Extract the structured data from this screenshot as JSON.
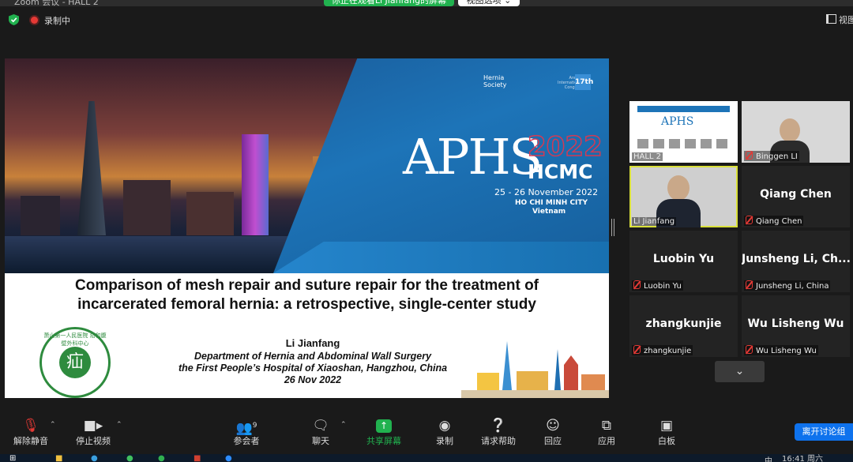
{
  "window": {
    "title": "Zoom 会议 - HALL 2",
    "share_banner": "你正在观看Li Jianfang的屏幕",
    "view_options": "视图选项 ⌄"
  },
  "top_bar": {
    "recording": "录制中",
    "view": "视图"
  },
  "slide": {
    "logo_society": "Hernia\nSociety",
    "logo_congress": "Annual\nInternational\nCongress",
    "logo_17": "17th",
    "brand": "APHS",
    "year": "2022",
    "city_code": "HCMC",
    "dates": "25 - 26 November 2022",
    "city": "HO CHI MINH CITY",
    "country": "Vietnam",
    "title_line1": "Comparison of mesh repair and suture repair for the treatment of",
    "title_line2": "incarcerated femoral hernia: a retrospective, single-center study",
    "author": "Li Jianfang",
    "affiliation1": "Department of Hernia and Abdominal Wall Surgery",
    "affiliation2": "the First People’s Hospital of Xiaoshan, Hangzhou, China",
    "date": "26 Nov 2022",
    "hospital_char": "疝",
    "hospital_ring": "萧山第一人民医院 疝和腹壁外科中心"
  },
  "participants": [
    {
      "label": "HALL 2",
      "muted": false
    },
    {
      "label": "Binggen LI",
      "muted": true
    },
    {
      "label": "Li Jianfang",
      "muted": false
    },
    {
      "name": "Qiang Chen",
      "label": "Qiang Chen",
      "muted": true
    },
    {
      "name": "Luobin Yu",
      "label": "Luobin Yu",
      "muted": true
    },
    {
      "name": "Junsheng  Li,  Ch...",
      "label": "Junsheng Li, China",
      "muted": true
    },
    {
      "name": "zhangkunjie",
      "label": "zhangkunjie",
      "muted": true
    },
    {
      "name": "Wu Lisheng Wu",
      "label": "Wu Lisheng Wu",
      "muted": true
    }
  ],
  "toolbar": {
    "unmute": "解除静音",
    "stop_video": "停止视频",
    "participants": "参会者",
    "participants_count": "9",
    "chat": "聊天",
    "share": "共享屏幕",
    "record": "录制",
    "help": "请求帮助",
    "react": "回应",
    "apps": "应用",
    "whiteboard": "白板",
    "leave_room": "离开讨论组"
  },
  "taskbar": {
    "time": "16:41 周六",
    "ime": "中"
  },
  "colors": {
    "green": "#21b24f",
    "blue_button": "#0e72ed",
    "banner_blue": "#1d74b8",
    "active_speaker": "#d9e03a"
  }
}
